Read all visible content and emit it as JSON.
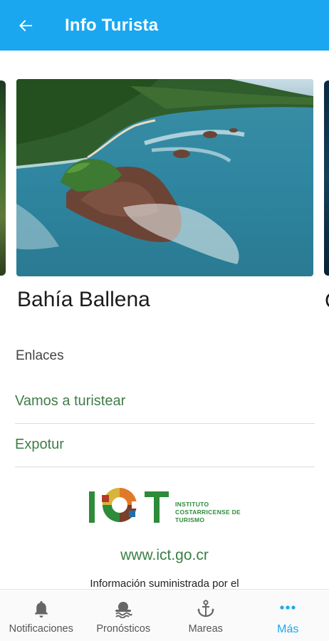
{
  "appbar": {
    "title": "Info Turista",
    "back_icon": "arrow-left-icon"
  },
  "carousel": {
    "current": {
      "title": "Bahía Ballena",
      "image": "aerial coastline photo"
    },
    "next_title_peek": "C"
  },
  "links_section": {
    "label": "Enlaces",
    "items": [
      {
        "label": "Vamos a turistear"
      },
      {
        "label": "Expotur"
      }
    ]
  },
  "footer": {
    "logo_text": [
      "INSTITUTO",
      "COSTARRICENSE DE",
      "TURISMO"
    ],
    "website": "www.ict.go.cr",
    "info": "Información suministrada por el"
  },
  "bottom_nav": {
    "items": [
      {
        "label": "Notificaciones",
        "icon": "bell-icon"
      },
      {
        "label": "Pronósticos",
        "icon": "weather-icon"
      },
      {
        "label": "Mareas",
        "icon": "anchor-icon"
      },
      {
        "label": "Más",
        "icon": "more-dots-icon",
        "active": true
      }
    ]
  },
  "colors": {
    "accent": "#1aa7f0",
    "link": "#3f7d48",
    "logo_green": "#2d8b3a"
  }
}
